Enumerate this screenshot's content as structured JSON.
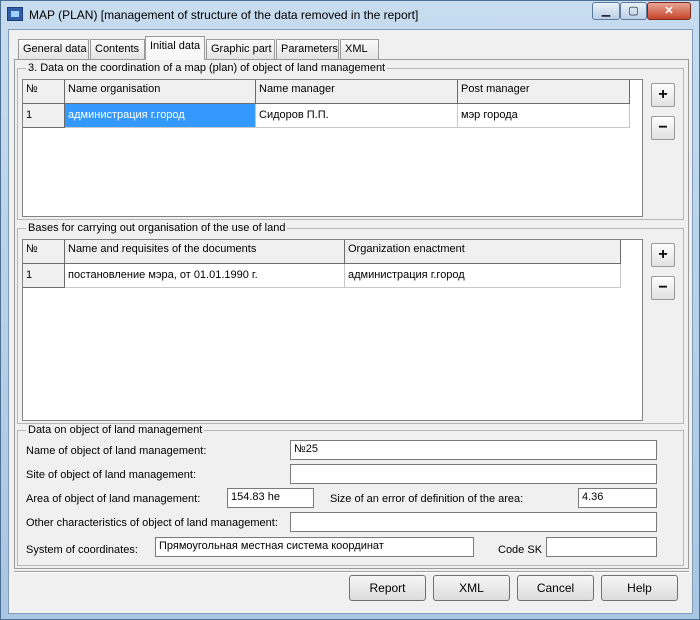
{
  "window": {
    "title": "MAP (PLAN) [management of structure of the data removed in the report]",
    "minimize": "▁",
    "maximize": "▢",
    "close": "✕"
  },
  "tabs": [
    {
      "label": "General data"
    },
    {
      "label": "Contents"
    },
    {
      "label": "Initial data",
      "active": true
    },
    {
      "label": "Graphic part"
    },
    {
      "label": "Parameters"
    },
    {
      "label": "XML"
    }
  ],
  "coordination": {
    "legend": "3. Data on the coordination of a map (plan) of object of land management",
    "columns": [
      "№",
      "Name organisation",
      "Name manager",
      "Post manager"
    ],
    "rows": [
      [
        "1",
        "администрация г.город",
        "Сидоров П.П.",
        "мэр города"
      ]
    ],
    "add": "+",
    "remove": "−"
  },
  "bases": {
    "legend": "Bases for carrying out organisation of the use of land",
    "columns": [
      "№",
      "Name and requisites of the documents",
      "Organization enactment"
    ],
    "rows": [
      [
        "1",
        "постановление мэра, от 01.01.1990 г.",
        "администрация г.город"
      ]
    ],
    "add": "+",
    "remove": "−"
  },
  "object": {
    "legend": "Data on object of land management",
    "name_label": "Name of object of land management:",
    "name_value": "№25",
    "site_label": "Site of object of land management:",
    "site_value": "",
    "area_label": "Area of object of land management:",
    "area_value": "154.83 he",
    "error_label": "Size of an error of definition of the area:",
    "error_value": "4.36",
    "other_label": "Other characteristics of object of land management:",
    "other_value": "",
    "system_label": "System of coordinates:",
    "system_value": "Прямоугольная местная система координат",
    "codesk_label": "Code SK",
    "codesk_value": ""
  },
  "buttons": {
    "report": "Report",
    "xml": "XML",
    "cancel": "Cancel",
    "help": "Help"
  }
}
